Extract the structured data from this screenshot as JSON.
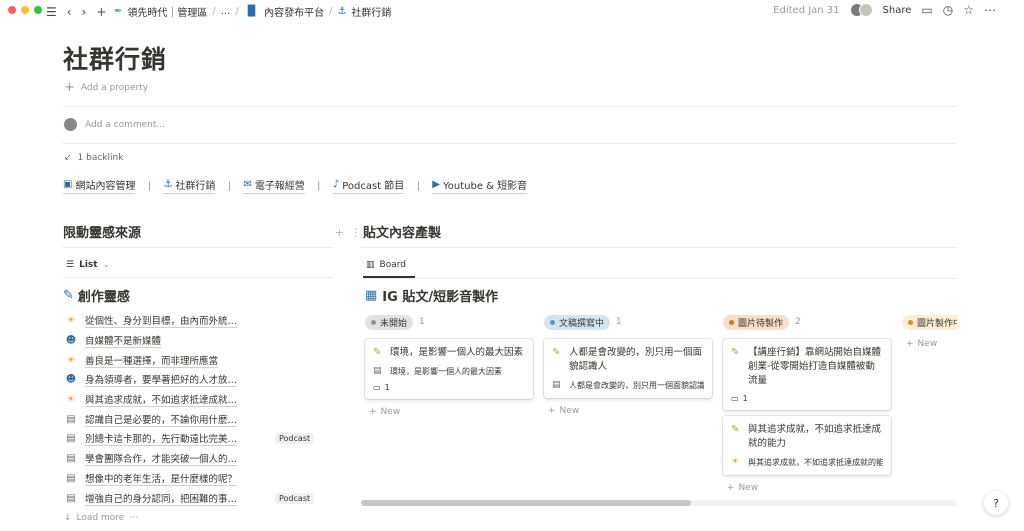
{
  "topbar": {
    "breadcrumbs": [
      {
        "icon": "feather-icon",
        "glyph": "✒",
        "label": "領先時代｜管理區"
      },
      {
        "icon": "",
        "glyph": "",
        "label": "..."
      },
      {
        "icon": "bar-chart-icon",
        "glyph": "📊",
        "label": "內容發布平台"
      },
      {
        "icon": "anchor-icon",
        "glyph": "⚓",
        "label": "社群行銷"
      }
    ],
    "edited": "Edited Jan 31",
    "share": "Share"
  },
  "page": {
    "title": "社群行銷",
    "add_property": "Add a property",
    "add_comment": "Add a comment...",
    "backlink": "1 backlink",
    "links": [
      {
        "icon": "monitor-icon",
        "glyph": "🖥",
        "label": "網站內容管理"
      },
      {
        "icon": "anchor-icon",
        "glyph": "⚓",
        "label": "社群行銷"
      },
      {
        "icon": "email-icon",
        "glyph": "📧",
        "label": "電子報經營"
      },
      {
        "icon": "podcast-icon",
        "glyph": "🎙",
        "label": "Podcast 節目"
      },
      {
        "icon": "youtube-icon",
        "glyph": "🎬",
        "label": "Youtube & 短影音"
      }
    ],
    "separator": "｜"
  },
  "left": {
    "heading": "限動靈感來源",
    "view_label": "List",
    "sub_heading": "創作靈感",
    "items": [
      {
        "icon": "sun-icon",
        "glyph": "🌞",
        "text": "從個性、身分到目標，由內而外統…",
        "tag": ""
      },
      {
        "icon": "speech-icon",
        "glyph": "🗣",
        "text": "自媒體不是新媒體",
        "tag": ""
      },
      {
        "icon": "sun-icon",
        "glyph": "🌞",
        "text": "善良是一種選擇，而非理所應當",
        "tag": ""
      },
      {
        "icon": "speech-icon",
        "glyph": "🗣",
        "text": "身為領導者，要學著把好的人才放…",
        "tag": ""
      },
      {
        "icon": "sun-icon",
        "glyph": "🌞",
        "text": "與其追求成就，不如追求抵達成就…",
        "tag": ""
      },
      {
        "icon": "page-icon",
        "glyph": "▤",
        "text": "認識自己是必要的，不論你用什麼…",
        "tag": ""
      },
      {
        "icon": "page-icon",
        "glyph": "▤",
        "text": "別總卡這卡那的，先行動遠比完美…",
        "tag": "Podcast"
      },
      {
        "icon": "page-icon",
        "glyph": "▤",
        "text": "學會團隊合作，才能突破一個人的…",
        "tag": ""
      },
      {
        "icon": "page-icon",
        "glyph": "▤",
        "text": "想像中的老年生活，是什麼樣的呢？",
        "tag": ""
      },
      {
        "icon": "page-icon",
        "glyph": "▤",
        "text": "增強自己的身分認同，把困難的事…",
        "tag": "Podcast"
      }
    ],
    "load_more": "Load more"
  },
  "board": {
    "heading": "貼文內容產製",
    "view_label": "Board",
    "sub_heading": "IG 貼文/短影音製作",
    "new_label": "New",
    "columns": [
      {
        "status": "未開始",
        "count": "1",
        "pill_bg": "#e3e2e0",
        "dot": "#91918e",
        "cards": [
          {
            "icon": "memo-icon",
            "glyph": "📝",
            "title": "環境，是影響一個人的最大因素",
            "sub_icon": "page-icon",
            "sub_glyph": "▤",
            "sub": "環境，是影響一個人的最大因素",
            "comments": "1"
          }
        ]
      },
      {
        "status": "文稿撰寫中",
        "count": "1",
        "pill_bg": "#d3e5ef",
        "dot": "#5b97bd",
        "cards": [
          {
            "icon": "memo-icon",
            "glyph": "📝",
            "title": "人都是會改變的，別只用一個面貌認識人",
            "sub_icon": "page-icon",
            "sub_glyph": "▤",
            "sub": "人都是會改變的，別只用一個面貌認識人",
            "comments": ""
          }
        ]
      },
      {
        "status": "圖片待製作",
        "count": "2",
        "pill_bg": "#fadec9",
        "dot": "#d9730d",
        "cards": [
          {
            "icon": "memo-icon",
            "glyph": "📝",
            "title": "【講座行銷】靠網站開始自媒體創業-從零開始打造自媒體被動流量",
            "sub_icon": "",
            "sub_glyph": "",
            "sub": "",
            "comments": "1"
          },
          {
            "icon": "memo-icon",
            "glyph": "📝",
            "title": "與其追求成就，不如追求抵達成就的能力",
            "sub_icon": "sun-icon",
            "sub_glyph": "🌞",
            "sub": "與其追求成就，不如追求抵達成就的能力",
            "comments": ""
          }
        ]
      },
      {
        "status": "圖片製作中",
        "count": "",
        "pill_bg": "#fbedd6",
        "dot": "#cb912f",
        "cards": []
      }
    ]
  },
  "help": "?"
}
